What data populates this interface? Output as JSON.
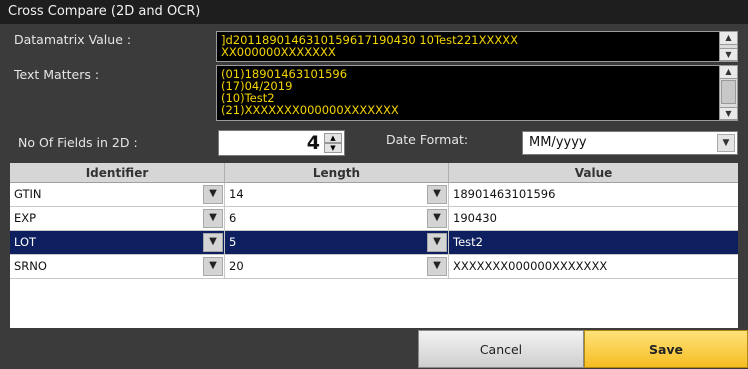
{
  "window": {
    "title": "Cross Compare (2D and OCR)"
  },
  "datamatrix": {
    "label": "Datamatrix Value :",
    "lines": [
      "]d2011890146310159617190430 10Test221XXXXX",
      "XX000000XXXXXXX"
    ]
  },
  "text_matters": {
    "label": "Text Matters :",
    "lines": [
      "(01)18901463101596",
      "(17)04/2019",
      "(10)Test2",
      "(21)XXXXXXX000000XXXXXXX"
    ]
  },
  "fields_2d": {
    "label": "No Of Fields in 2D :",
    "value": "4"
  },
  "date_format": {
    "label": "Date Format:",
    "value": "MM/yyyy"
  },
  "grid": {
    "headers": [
      "Identifier",
      "Length",
      "Value"
    ],
    "rows": [
      {
        "identifier": "GTIN",
        "length": "14",
        "value": "18901463101596"
      },
      {
        "identifier": "EXP",
        "length": "6",
        "value": "190430"
      },
      {
        "identifier": "LOT",
        "length": "5",
        "value": "Test2"
      },
      {
        "identifier": "SRNO",
        "length": "20",
        "value": "XXXXXXX000000XXXXXXX"
      }
    ],
    "selected_index": 2
  },
  "buttons": {
    "cancel": "Cancel",
    "save": "Save"
  },
  "colors": {
    "selection": "#0d1f5e",
    "save": "#f8c93a",
    "text_highlight": "#f5d600"
  }
}
